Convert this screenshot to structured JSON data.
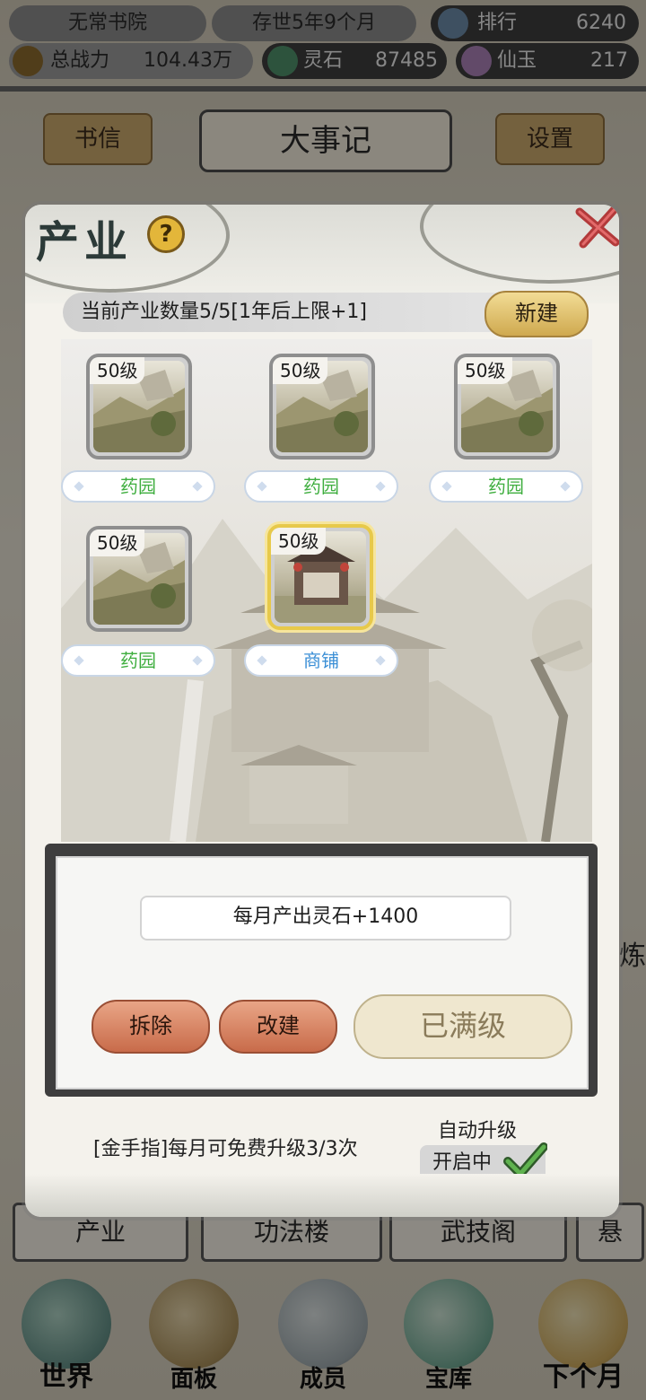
{
  "hud": {
    "academy": "无常书院",
    "time": "存世5年9个月",
    "rank_label": "排行",
    "rank_value": "6240",
    "power_label": "总战力",
    "power_value": "104.43万",
    "stone_label": "灵石",
    "stone_value": "87485",
    "jade_label": "仙玉",
    "jade_value": "217"
  },
  "bg_tabs": {
    "letters": "书信",
    "title": "大事记",
    "settings": "设置"
  },
  "bg_bottom_tabs": [
    "产业",
    "功法楼",
    "武技阁",
    "悬"
  ],
  "bg_side_text": "炼",
  "nav": [
    "世界",
    "面板",
    "成员",
    "宝库",
    "下个月"
  ],
  "dialog": {
    "title": "产业",
    "help": "?",
    "count_text": "当前产业数量5/5[1年后上限+1]",
    "new_button": "新建",
    "industries": [
      {
        "level": "50级",
        "name": "药园",
        "type": "garden",
        "selected": false
      },
      {
        "level": "50级",
        "name": "药园",
        "type": "garden",
        "selected": false
      },
      {
        "level": "50级",
        "name": "药园",
        "type": "garden",
        "selected": false
      },
      {
        "level": "50级",
        "name": "药园",
        "type": "garden",
        "selected": false
      },
      {
        "level": "50级",
        "name": "商铺",
        "type": "shop",
        "selected": true
      }
    ],
    "output_text": "每月产出灵石+1400",
    "demolish_button": "拆除",
    "rebuild_button": "改建",
    "maxed_button": "已满级",
    "gold_finger_text": "[金手指]每月可免费升级3/3次",
    "auto_upgrade_label": "自动升级",
    "auto_upgrade_state": "开启中"
  },
  "colors": {
    "garden_label": "#3fae3f",
    "shop_label": "#3b8fd6",
    "selected_border": "#e7c94b"
  }
}
